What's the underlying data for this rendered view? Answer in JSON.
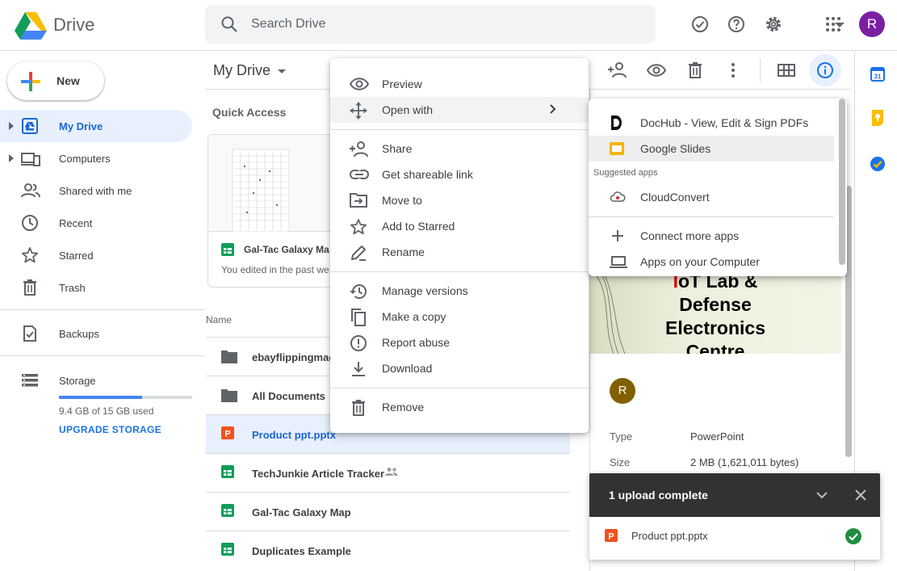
{
  "app": {
    "name": "Drive"
  },
  "search": {
    "placeholder": "Search Drive"
  },
  "user": {
    "initial": "R"
  },
  "sidebar": {
    "new_label": "New",
    "items": [
      {
        "label": "My Drive"
      },
      {
        "label": "Computers"
      },
      {
        "label": "Shared with me"
      },
      {
        "label": "Recent"
      },
      {
        "label": "Starred"
      },
      {
        "label": "Trash"
      },
      {
        "label": "Backups"
      },
      {
        "label": "Storage"
      }
    ],
    "storage_used": "9.4 GB of 15 GB used",
    "storage_fraction": 0.627,
    "upgrade_label": "UPGRADE STORAGE"
  },
  "main": {
    "title": "My Drive",
    "quick_access": "Quick Access",
    "qa_card": {
      "name": "Gal-Tac Galaxy Ma",
      "sub": "You edited in the past we"
    },
    "col_name": "Name",
    "files": [
      {
        "name": "ebayflippingmag",
        "type": "folder"
      },
      {
        "name": "All Documents",
        "type": "folder"
      },
      {
        "name": "Product ppt.pptx",
        "type": "slides"
      },
      {
        "name": "TechJunkie Article Tracker",
        "type": "sheet"
      },
      {
        "name": "Gal-Tac Galaxy Map",
        "type": "sheet"
      },
      {
        "name": "Duplicates Example",
        "type": "sheet"
      }
    ]
  },
  "context_menu": {
    "items": [
      {
        "label": "Preview"
      },
      {
        "label": "Open with"
      },
      {
        "label": "Share"
      },
      {
        "label": "Get shareable link"
      },
      {
        "label": "Move to"
      },
      {
        "label": "Add to Starred"
      },
      {
        "label": "Rename"
      },
      {
        "label": "Manage versions"
      },
      {
        "label": "Make a copy"
      },
      {
        "label": "Report abuse"
      },
      {
        "label": "Download"
      },
      {
        "label": "Remove"
      }
    ]
  },
  "submenu": {
    "items": [
      {
        "label": "DocHub - View, Edit & Sign PDFs"
      },
      {
        "label": "Google Slides"
      },
      {
        "label": "CloudConvert"
      },
      {
        "label": "Connect more apps"
      },
      {
        "label": "Apps on your Computer"
      }
    ],
    "suggested_label": "Suggested apps"
  },
  "details": {
    "preview_lines": [
      "IoT Lab &",
      "Defense",
      "Electronics",
      "Centre"
    ],
    "avatar_initial": "R",
    "rows": [
      {
        "label": "Type",
        "value": "PowerPoint"
      },
      {
        "label": "Size",
        "value": "2 MB (1,621,011 bytes)"
      }
    ]
  },
  "toast": {
    "title": "1 upload complete",
    "file": "Product ppt.pptx"
  },
  "colors": {
    "accent": "#1a73e8",
    "active_bg": "#e8f0fe",
    "toast_bg": "#323232",
    "success": "#1e8e3e",
    "slides": "#f4511e",
    "sheets": "#0f9d58"
  }
}
